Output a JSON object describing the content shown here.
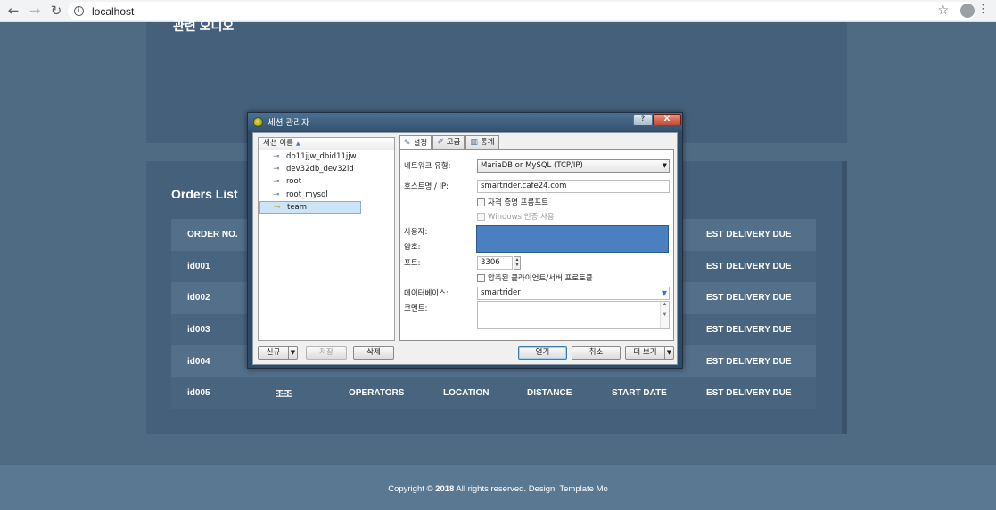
{
  "browser": {
    "back_icon": "arrow-left-icon",
    "url": "localhost"
  },
  "page": {
    "cut_heading": "관련 오디오",
    "orders_title": "Orders List",
    "table": {
      "headers": [
        "ORDER NO.",
        "",
        "",
        "",
        "",
        "",
        "EST DELIVERY DUE"
      ],
      "rows": [
        [
          "id001",
          "",
          "",
          "",
          "",
          "",
          "EST DELIVERY DUE"
        ],
        [
          "id002",
          "",
          "",
          "",
          "",
          "",
          "EST DELIVERY DUE"
        ],
        [
          "id003",
          "",
          "",
          "",
          "",
          "",
          "EST DELIVERY DUE"
        ],
        [
          "id004",
          "",
          "",
          "",
          "",
          "",
          "EST DELIVERY DUE"
        ],
        [
          "id005",
          "조조",
          "OPERATORS",
          "LOCATION",
          "DISTANCE",
          "START DATE",
          "EST DELIVERY DUE"
        ]
      ]
    },
    "footer": {
      "prefix": "Copyright © ",
      "year": "2018",
      "suffix": " All rights reserved. Design: Template Mo"
    }
  },
  "dialog": {
    "title": "세션 관리자",
    "help_label": "?",
    "close_label": "X",
    "tree_header": "세션 이름",
    "sessions": [
      "db11jjw_dbid11jjw",
      "dev32db_dev32id",
      "root",
      "root_mysql",
      "team"
    ],
    "selected_session": "team",
    "tabs": [
      "설정",
      "고급",
      "통계"
    ],
    "fields": {
      "network_type_label": "네트워크 유형:",
      "network_type_value": "MariaDB or MySQL (TCP/IP)",
      "host_label": "호스트명 / IP:",
      "host_value": "smartrider.cafe24.com",
      "prompt_credentials": "자격 증명 프롬프트",
      "windows_auth": "Windows 인증 사용",
      "user_label": "사용자:",
      "password_label": "암호:",
      "port_label": "포트:",
      "port_value": "3306",
      "compression": "압축된 클라이언트/서버 프로토콜",
      "database_label": "데이터베이스:",
      "database_value": "smartrider",
      "comment_label": "코멘트:"
    },
    "buttons": {
      "new": "신규",
      "save": "저장",
      "delete": "삭제",
      "open": "열기",
      "cancel": "취소",
      "more": "더 보기"
    }
  }
}
